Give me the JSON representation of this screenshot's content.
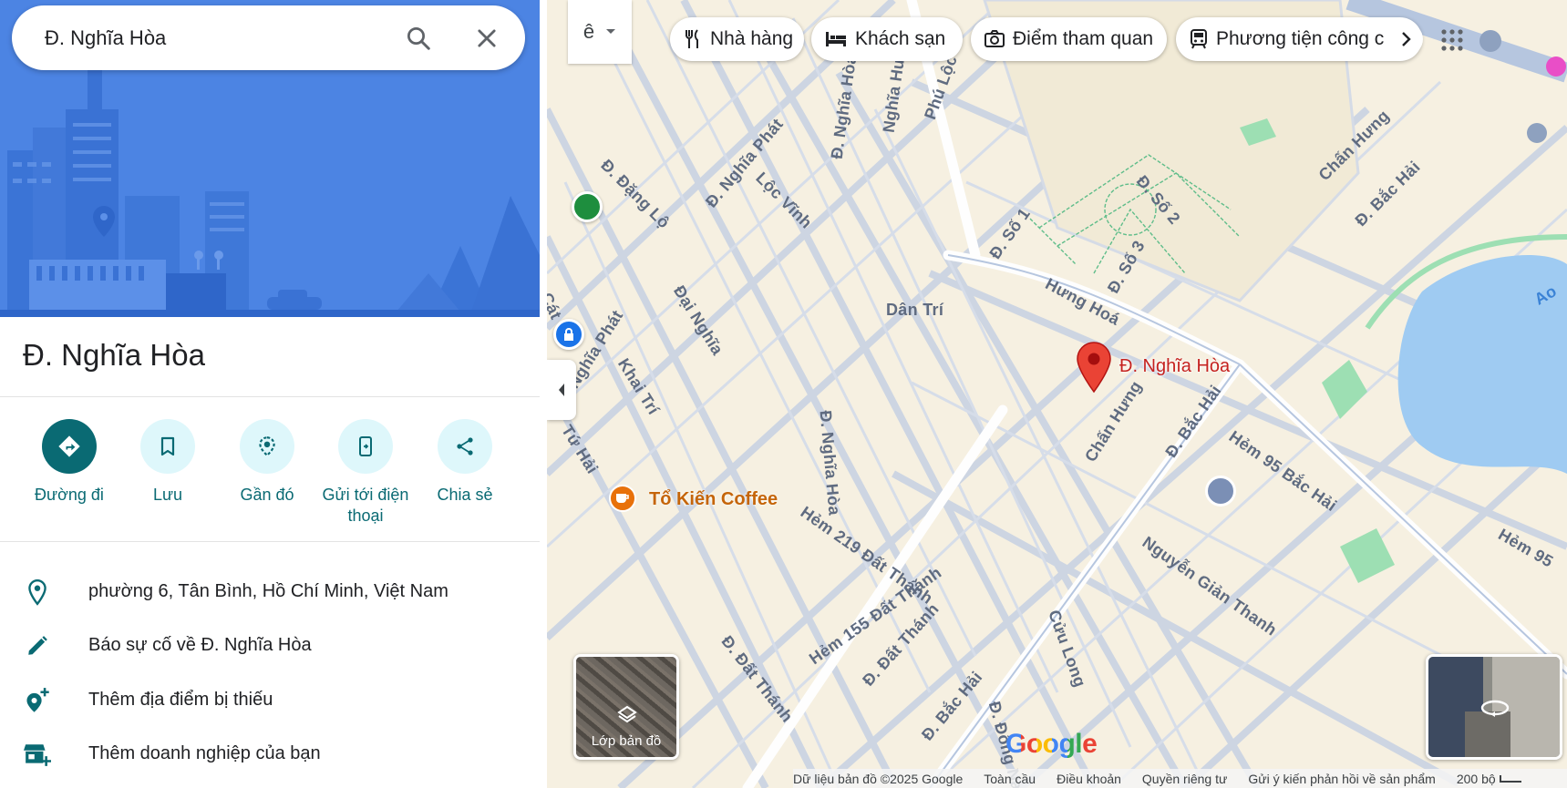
{
  "search": {
    "value": "Đ. Nghĩa Hòa"
  },
  "place": {
    "title": "Đ. Nghĩa Hòa"
  },
  "actions": [
    {
      "label": "Đường đi"
    },
    {
      "label": "Lưu"
    },
    {
      "label": "Gần đó"
    },
    {
      "label": "Gửi tới điện thoại"
    },
    {
      "label": "Chia sẻ"
    }
  ],
  "info": [
    {
      "text": "phường 6, Tân Bình, Hồ Chí Minh, Việt Nam",
      "icon": "location-pin-icon"
    },
    {
      "text": "Báo sự cố về Đ. Nghĩa Hòa",
      "icon": "pencil-icon"
    },
    {
      "text": "Thêm địa điểm bị thiếu",
      "icon": "add-place-icon"
    },
    {
      "text": "Thêm doanh nghiệp của bạn",
      "icon": "add-business-icon"
    }
  ],
  "map": {
    "transit_toggle": "ê",
    "chips": [
      {
        "label": "Nhà hàng",
        "icon": "fork-knife-icon"
      },
      {
        "label": "Khách sạn",
        "icon": "bed-icon"
      },
      {
        "label": "Điểm tham quan",
        "icon": "camera-icon"
      },
      {
        "label": "Phương tiện công c",
        "icon": "train-icon"
      }
    ],
    "streets": [
      "Đ. Đặng Lộ",
      "Đ. Nghĩa Phát",
      "Lộc Vĩnh",
      "Đ. Nghĩa Hòa",
      "Nghĩa Hưng",
      "Phú Lộc",
      "Đ. Số 1",
      "Đ. Số 2",
      "Đ. Số 3",
      "Hưng Hoá",
      "Dân Trí",
      "Đại Nghĩa",
      "Đ.Nghĩa Phát",
      "Khai Trí",
      "Tứ Hải",
      "Cát",
      "Đ. Nghĩa Hòa",
      "Chấn Hưng",
      "Đ. Bắc Hải",
      "Hẻm 95 Bắc Hải",
      "Nguyễn Giản Thanh",
      "Hẻm 219 Đất Thánh",
      "Hẻm 155 Đất Thánh",
      "Đ. Đất Thánh",
      "Đ. Đất Thánh",
      "Cửu Long",
      "Đ. Bắc Hải",
      "Đ. Đông Na",
      "Chấn Hưng",
      "Đ. Bắc Hải",
      "Hẻm 95",
      "Ao"
    ],
    "pin_label": "Đ. Nghĩa Hòa",
    "poi_coffee": "Tổ Kiến Coffee",
    "layers_label": "Lớp bản đồ",
    "google_logo": "Google",
    "footer": {
      "data": "Dữ liệu bản đồ ©2025 Google",
      "global": "Toàn cầu",
      "terms": "Điều khoản",
      "privacy": "Quyền riêng tư",
      "feedback": "Gửi ý kiến phản hồi về sản phẩm",
      "scale": "200 bộ"
    },
    "colors": {
      "pin": "#ea4335",
      "coffee": "#e8710a",
      "teal": "#0a6a73",
      "park": "#9ddfb3",
      "water": "#9fcbf2"
    }
  }
}
